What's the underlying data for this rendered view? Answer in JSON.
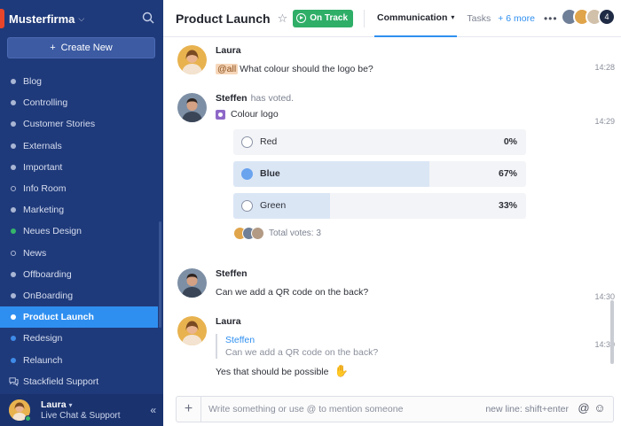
{
  "org": {
    "name": "Musterfirma"
  },
  "sidebar": {
    "create_label": "Create New",
    "items": [
      {
        "label": "Blog",
        "dot": "plain"
      },
      {
        "label": "Controlling",
        "dot": "plain"
      },
      {
        "label": "Customer Stories",
        "dot": "plain"
      },
      {
        "label": "Externals",
        "dot": "plain"
      },
      {
        "label": "Important",
        "dot": "plain"
      },
      {
        "label": "Info Room",
        "dot": "ring"
      },
      {
        "label": "Marketing",
        "dot": "plain"
      },
      {
        "label": "Neues Design",
        "dot": "green"
      },
      {
        "label": "News",
        "dot": "ring"
      },
      {
        "label": "Offboarding",
        "dot": "plain"
      },
      {
        "label": "OnBoarding",
        "dot": "plain"
      },
      {
        "label": "Product Launch",
        "dot": "white",
        "active": true
      },
      {
        "label": "Redesign",
        "dot": "blue"
      },
      {
        "label": "Relaunch",
        "dot": "blue"
      },
      {
        "label": "Stackfield Support",
        "dot": "support"
      }
    ],
    "user": {
      "name": "Laura",
      "subtitle": "Live Chat & Support"
    }
  },
  "header": {
    "title": "Product Launch",
    "status": "On Track",
    "tabs": [
      {
        "label": "Communication",
        "active": true
      },
      {
        "label": "Tasks"
      }
    ],
    "more_label": "+ 6 more",
    "member_count": "4"
  },
  "messages": [
    {
      "author": "Laura",
      "mention": "@all",
      "text": "What colour should the logo be?",
      "time": "14:28"
    },
    {
      "author": "Steffen",
      "note": "has voted.",
      "time": "14:29",
      "poll": {
        "title": "Colour logo",
        "options": [
          {
            "label": "Red",
            "percent": "0%",
            "value": 0,
            "selected": false
          },
          {
            "label": "Blue",
            "percent": "67%",
            "value": 67,
            "selected": true
          },
          {
            "label": "Green",
            "percent": "33%",
            "value": 33,
            "selected": false
          }
        ],
        "total": "Total votes: 3"
      }
    },
    {
      "author": "Steffen",
      "text": "Can we add a QR code on the back?",
      "time": "14:30"
    },
    {
      "author": "Laura",
      "time": "14:30",
      "quote": {
        "author": "Steffen",
        "text": "Can we add a QR code on the back?"
      },
      "text": "Yes that should be possible"
    }
  ],
  "composer": {
    "placeholder": "Write something or use @ to mention someone",
    "hint": "new line: shift+enter"
  },
  "colors": {
    "sidebar": "#1f3a7a",
    "accent": "#2f8ff0",
    "status": "#2fae68"
  }
}
